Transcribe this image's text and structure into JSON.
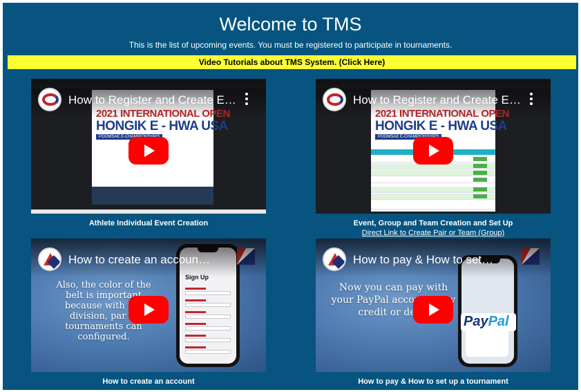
{
  "header": {
    "title": "Welcome to TMS",
    "subtitle": "This is the list of upcoming events. You must be registered to participate in tournaments."
  },
  "banner": {
    "label": "Video Tutorials about TMS System. (Click Here)",
    "color": "#ffff33"
  },
  "colors": {
    "page_background": "#06547f",
    "play_button": "#ff0000"
  },
  "videos": [
    {
      "overlay_title": "How to Register and Create Even...",
      "caption": "Athlete Individual Event Creation",
      "poster_line1": "2021 INTERNATIONAL OPEN",
      "poster_line2": "HONGIK E - HWA USA",
      "poster_line3": "POOMSAE E-CHAMPIONSHIPS",
      "channel_icon": "swirl-logo-icon"
    },
    {
      "overlay_title": "How to Register and Create Even...",
      "caption": "Event, Group and Team Creation and Set Up",
      "link": "Direct Link to Create Pair or Team (Group)",
      "poster_line1": "2021 INTERNATIONAL OPEN",
      "poster_line2": "HONGIK E - HWA USA",
      "poster_line3": "POOMSAE E-CHAMPIONSHIPS",
      "channel_icon": "swirl-logo-icon"
    },
    {
      "overlay_title": "How to create an account at inth...",
      "caption": "How to create an account",
      "overlay_text": "Also, the color of the belt is important because with the division, par in tournaments can configured.",
      "phone_heading": "Sign Up",
      "channel_icon": "tms-logo-icon"
    },
    {
      "overlay_title": "How to pay & How to set up a tou...",
      "caption": "How to pay & How to set up a tournament",
      "overlay_text": "Now you can pay with your PayPal account or w credit or debit",
      "paypal_a": "Pay",
      "paypal_b": "Pal",
      "channel_icon": "tms-logo-icon"
    }
  ]
}
